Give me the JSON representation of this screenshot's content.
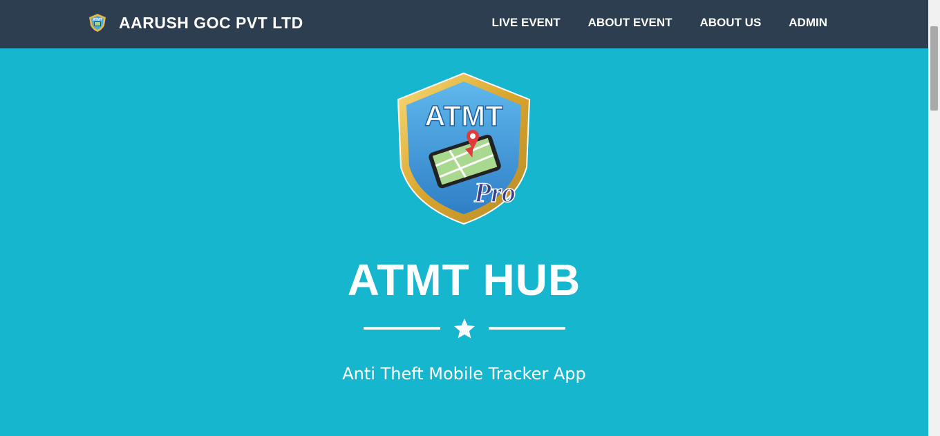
{
  "navbar": {
    "brand": "AARUSH GOC PVT LTD",
    "brand_icon": "shield-logo-icon",
    "links": [
      "LIVE EVENT",
      "ABOUT EVENT",
      "ABOUT US",
      "ADMIN"
    ]
  },
  "masthead": {
    "logo_text": "ATMT",
    "logo_sub": "Pro",
    "title": "ATMT HUB",
    "subtitle": "Anti Theft Mobile Tracker App",
    "divider_icon": "star-icon"
  },
  "colors": {
    "navbar_bg": "#2c3e50",
    "masthead_bg": "#16b6cf",
    "text": "#ffffff"
  }
}
